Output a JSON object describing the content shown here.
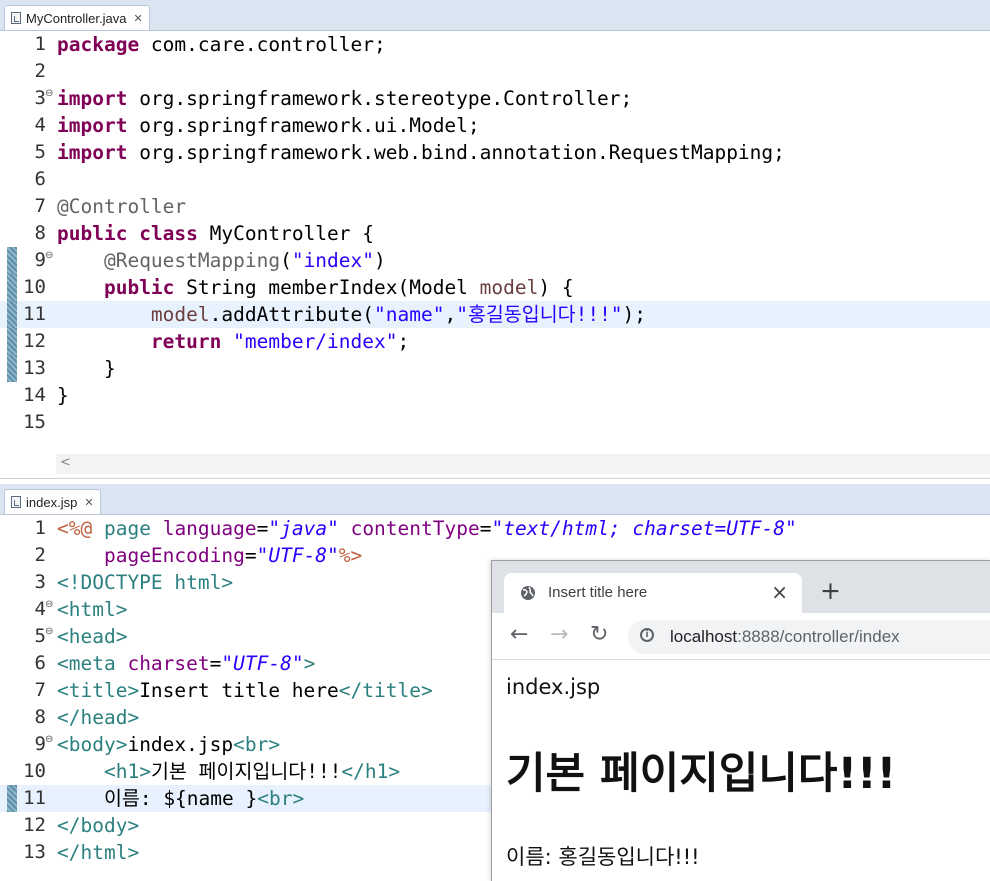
{
  "java_editor": {
    "tab_label": "MyController.java",
    "lines": [
      {
        "n": "1",
        "tokens": [
          {
            "t": "package",
            "c": "kw"
          },
          {
            "t": " com.care.controller;",
            "c": "plain"
          }
        ]
      },
      {
        "n": "2",
        "tokens": []
      },
      {
        "n": "3",
        "fold": true,
        "tokens": [
          {
            "t": "import",
            "c": "kw"
          },
          {
            "t": " org.springframework.stereotype.Controller;",
            "c": "plain"
          }
        ]
      },
      {
        "n": "4",
        "tokens": [
          {
            "t": "import",
            "c": "kw"
          },
          {
            "t": " org.springframework.ui.Model;",
            "c": "plain"
          }
        ]
      },
      {
        "n": "5",
        "tokens": [
          {
            "t": "import",
            "c": "kw"
          },
          {
            "t": " org.springframework.web.bind.annotation.RequestMapping;",
            "c": "plain"
          }
        ]
      },
      {
        "n": "6",
        "tokens": []
      },
      {
        "n": "7",
        "tokens": [
          {
            "t": "@Controller",
            "c": "ann"
          }
        ]
      },
      {
        "n": "8",
        "tokens": [
          {
            "t": "public",
            "c": "kw"
          },
          {
            "t": " ",
            "c": "plain"
          },
          {
            "t": "class",
            "c": "kw"
          },
          {
            "t": " MyController {",
            "c": "plain"
          }
        ]
      },
      {
        "n": "9",
        "fold": true,
        "marker": true,
        "tokens": [
          {
            "t": "    ",
            "c": "plain"
          },
          {
            "t": "@RequestMapping",
            "c": "ann"
          },
          {
            "t": "(",
            "c": "plain"
          },
          {
            "t": "\"index\"",
            "c": "str"
          },
          {
            "t": ")",
            "c": "plain"
          }
        ]
      },
      {
        "n": "10",
        "marker": true,
        "tokens": [
          {
            "t": "    ",
            "c": "plain"
          },
          {
            "t": "public",
            "c": "kw"
          },
          {
            "t": " String memberIndex(Model ",
            "c": "plain"
          },
          {
            "t": "model",
            "c": "var"
          },
          {
            "t": ") {",
            "c": "plain"
          }
        ]
      },
      {
        "n": "11",
        "marker": true,
        "current": true,
        "tokens": [
          {
            "t": "        ",
            "c": "plain"
          },
          {
            "t": "model",
            "c": "var"
          },
          {
            "t": ".addAttribute(",
            "c": "plain"
          },
          {
            "t": "\"name\"",
            "c": "str"
          },
          {
            "t": ",",
            "c": "plain"
          },
          {
            "t": "\"홍길동입니다!!!\"",
            "c": "str"
          },
          {
            "t": ");",
            "c": "plain"
          }
        ]
      },
      {
        "n": "12",
        "marker": true,
        "tokens": [
          {
            "t": "        ",
            "c": "plain"
          },
          {
            "t": "return",
            "c": "kw"
          },
          {
            "t": " ",
            "c": "plain"
          },
          {
            "t": "\"member/index\"",
            "c": "str"
          },
          {
            "t": ";",
            "c": "plain"
          }
        ]
      },
      {
        "n": "13",
        "marker": true,
        "tokens": [
          {
            "t": "    }",
            "c": "plain"
          }
        ]
      },
      {
        "n": "14",
        "tokens": [
          {
            "t": "}",
            "c": "plain"
          }
        ]
      },
      {
        "n": "15",
        "tokens": []
      }
    ],
    "hscroll_arrow": "<"
  },
  "jsp_editor": {
    "tab_label": "index.jsp",
    "lines": [
      {
        "n": "1",
        "tokens": [
          {
            "t": "<%@",
            "c": "dir"
          },
          {
            "t": " ",
            "c": "plain"
          },
          {
            "t": "page",
            "c": "tag"
          },
          {
            "t": " ",
            "c": "plain"
          },
          {
            "t": "language",
            "c": "attr"
          },
          {
            "t": "=",
            "c": "plain"
          },
          {
            "t": "\"java\"",
            "c": "aval"
          },
          {
            "t": " ",
            "c": "plain"
          },
          {
            "t": "contentType",
            "c": "attr"
          },
          {
            "t": "=",
            "c": "plain"
          },
          {
            "t": "\"text/html; charset=UTF-8\"",
            "c": "aval"
          }
        ]
      },
      {
        "n": "2",
        "tokens": [
          {
            "t": "    ",
            "c": "plain"
          },
          {
            "t": "pageEncoding",
            "c": "attr"
          },
          {
            "t": "=",
            "c": "plain"
          },
          {
            "t": "\"UTF-8\"",
            "c": "aval"
          },
          {
            "t": "%>",
            "c": "dir"
          }
        ]
      },
      {
        "n": "3",
        "tokens": [
          {
            "t": "<!DOCTYPE ",
            "c": "tag"
          },
          {
            "t": "html",
            "c": "tag"
          },
          {
            "t": ">",
            "c": "tag"
          }
        ]
      },
      {
        "n": "4",
        "fold": true,
        "tokens": [
          {
            "t": "<html>",
            "c": "tag"
          }
        ]
      },
      {
        "n": "5",
        "fold": true,
        "tokens": [
          {
            "t": "<head>",
            "c": "tag"
          }
        ]
      },
      {
        "n": "6",
        "tokens": [
          {
            "t": "<meta",
            "c": "tag"
          },
          {
            "t": " ",
            "c": "plain"
          },
          {
            "t": "charset",
            "c": "attr"
          },
          {
            "t": "=",
            "c": "plain"
          },
          {
            "t": "\"UTF-8\"",
            "c": "aval"
          },
          {
            "t": ">",
            "c": "tag"
          }
        ]
      },
      {
        "n": "7",
        "tokens": [
          {
            "t": "<title>",
            "c": "tag"
          },
          {
            "t": "Insert title here",
            "c": "plain"
          },
          {
            "t": "</title>",
            "c": "tag"
          }
        ]
      },
      {
        "n": "8",
        "tokens": [
          {
            "t": "</head>",
            "c": "tag"
          }
        ]
      },
      {
        "n": "9",
        "fold": true,
        "tokens": [
          {
            "t": "<body>",
            "c": "tag"
          },
          {
            "t": "index.jsp",
            "c": "plain"
          },
          {
            "t": "<br>",
            "c": "tag"
          }
        ]
      },
      {
        "n": "10",
        "tokens": [
          {
            "t": "    ",
            "c": "plain"
          },
          {
            "t": "<h1>",
            "c": "tag"
          },
          {
            "t": "기본 페이지입니다!!!",
            "c": "plain"
          },
          {
            "t": "</h1>",
            "c": "tag"
          }
        ]
      },
      {
        "n": "11",
        "marker": true,
        "current": true,
        "tokens": [
          {
            "t": "    이름: ${name }",
            "c": "plain"
          },
          {
            "t": "<br>",
            "c": "tag"
          }
        ]
      },
      {
        "n": "12",
        "tokens": [
          {
            "t": "</body>",
            "c": "tag"
          }
        ]
      },
      {
        "n": "13",
        "tokens": [
          {
            "t": "</html>",
            "c": "tag"
          }
        ]
      }
    ]
  },
  "browser": {
    "tab_title": "Insert title here",
    "tab_close": "×",
    "new_tab": "+",
    "back": "←",
    "forward": "→",
    "reload": "↻",
    "info_glyph": "i",
    "url_host": "localhost",
    "url_rest": ":8888/controller/index",
    "content": {
      "line1": "index.jsp",
      "heading": "기본 페이지입니다!!!",
      "line3": "이름: 홍길동입니다!!!"
    }
  },
  "colors": {
    "keyword": "#7f0055",
    "string": "#2a00ff",
    "annotation": "#646464",
    "tag": "#2c8080",
    "current_line": "#e8f2fe",
    "tab_strip": "#dbe5f1"
  }
}
